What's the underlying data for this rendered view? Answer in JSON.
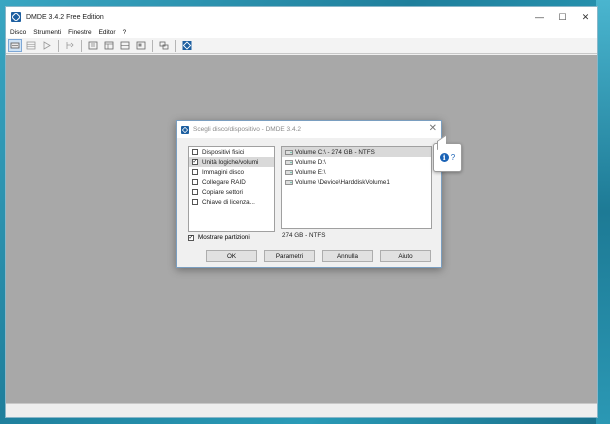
{
  "window": {
    "title": "DMDE 3.4.2 Free Edition",
    "controls": [
      "—",
      "☐",
      "✕"
    ]
  },
  "menu": [
    "Disco",
    "Strumenti",
    "Finestre",
    "Editor",
    "?"
  ],
  "toolbar": {
    "icons": [
      "open-disk-icon",
      "partitions-icon",
      "play-icon",
      "file-panel-icon",
      "editor-icon",
      "list-icon",
      "table-icon",
      "image-icon",
      "clone-icon",
      "dmde-logo-icon"
    ]
  },
  "dialog": {
    "title": "Scegli disco/dispositivo - DMDE 3.4.2",
    "close": "✕",
    "options": [
      {
        "label": "Dispositivi fisici",
        "checked": false
      },
      {
        "label": "Unità logiche/volumi",
        "checked": true
      },
      {
        "label": "Immagini disco",
        "checked": false
      },
      {
        "label": "Collegare RAID",
        "checked": false
      },
      {
        "label": "Copiare settori",
        "checked": false
      },
      {
        "label": "Chiave di licenza...",
        "checked": false
      }
    ],
    "volumes": [
      "Volume C:\\ - 274 GB - NTFS",
      "Volume D:\\",
      "Volume E:\\",
      "Volume \\Device\\HarddiskVolume1"
    ],
    "show_partitions": "Mostrare partizioni",
    "info": "274 GB - NTFS",
    "buttons": {
      "ok": "OK",
      "params": "Parametri",
      "cancel": "Annulla",
      "help": "Aiuto"
    }
  },
  "tooltip": {
    "q": "?"
  }
}
